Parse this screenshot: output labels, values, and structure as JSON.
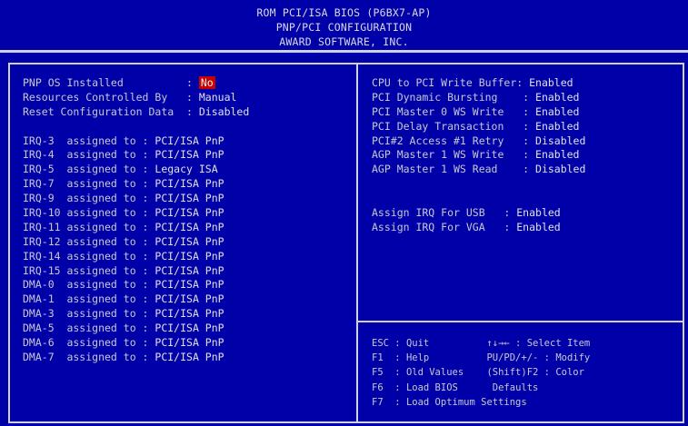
{
  "header": {
    "line1": "ROM PCI/ISA BIOS (P6BX7-AP)",
    "line2": "PNP/PCI CONFIGURATION",
    "line3": "AWARD SOFTWARE, INC."
  },
  "left_top": [
    {
      "label": "PNP OS Installed          : ",
      "value": "No"
    },
    {
      "label": "Resources Controlled By   : ",
      "value": "Manual"
    },
    {
      "label": "Reset Configuration Data  : ",
      "value": "Disabled"
    }
  ],
  "irq_rows": [
    {
      "label": "IRQ-3  assigned to : ",
      "value": "PCI/ISA PnP"
    },
    {
      "label": "IRQ-4  assigned to : ",
      "value": "PCI/ISA PnP"
    },
    {
      "label": "IRQ-5  assigned to : ",
      "value": "Legacy ISA"
    },
    {
      "label": "IRQ-7  assigned to : ",
      "value": "PCI/ISA PnP"
    },
    {
      "label": "IRQ-9  assigned to : ",
      "value": "PCI/ISA PnP"
    },
    {
      "label": "IRQ-10 assigned to : ",
      "value": "PCI/ISA PnP"
    },
    {
      "label": "IRQ-11 assigned to : ",
      "value": "PCI/ISA PnP"
    },
    {
      "label": "IRQ-12 assigned to : ",
      "value": "PCI/ISA PnP"
    },
    {
      "label": "IRQ-14 assigned to : ",
      "value": "PCI/ISA PnP"
    },
    {
      "label": "IRQ-15 assigned to : ",
      "value": "PCI/ISA PnP"
    },
    {
      "label": "DMA-0  assigned to : ",
      "value": "PCI/ISA PnP"
    },
    {
      "label": "DMA-1  assigned to : ",
      "value": "PCI/ISA PnP"
    },
    {
      "label": "DMA-3  assigned to : ",
      "value": "PCI/ISA PnP"
    },
    {
      "label": "DMA-5  assigned to : ",
      "value": "PCI/ISA PnP"
    },
    {
      "label": "DMA-6  assigned to : ",
      "value": "PCI/ISA PnP"
    },
    {
      "label": "DMA-7  assigned to : ",
      "value": "PCI/ISA PnP"
    }
  ],
  "right_rows": [
    {
      "label": "CPU to PCI Write Buffer: ",
      "value": "Enabled"
    },
    {
      "label": "PCI Dynamic Bursting    : ",
      "value": "Enabled"
    },
    {
      "label": "PCI Master 0 WS Write   : ",
      "value": "Enabled"
    },
    {
      "label": "PCI Delay Transaction   : ",
      "value": "Enabled"
    },
    {
      "label": "PCI#2 Access #1 Retry   : ",
      "value": "Disabled"
    },
    {
      "label": "AGP Master 1 WS Write   : ",
      "value": "Enabled"
    },
    {
      "label": "AGP Master 1 WS Read    : ",
      "value": "Disabled"
    }
  ],
  "right_rows2": [
    {
      "label": "Assign IRQ For USB   : ",
      "value": "Enabled"
    },
    {
      "label": "Assign IRQ For VGA   : ",
      "value": "Enabled"
    }
  ],
  "help": [
    {
      "key": "ESC : ",
      "desc": "Quit          ",
      "key2": "↑↓→← : ",
      "desc2": "Select Item"
    },
    {
      "key": "F1  : ",
      "desc": "Help          ",
      "key2": "PU/PD/+/- : ",
      "desc2": "Modify"
    },
    {
      "key": "F5  : ",
      "desc": "Old Values    ",
      "key2": "(Shift)F2 : ",
      "desc2": "Color"
    },
    {
      "key": "F6  : ",
      "desc": "Load BIOS     ",
      "key2": " ",
      "desc2": "Defaults"
    },
    {
      "key": "F7  : ",
      "desc": "Load Optimum Settings",
      "key2": "",
      "desc2": ""
    }
  ],
  "colors": {
    "background": "#0000a8",
    "selected": "#c80000",
    "text": "#c8c8d8"
  }
}
